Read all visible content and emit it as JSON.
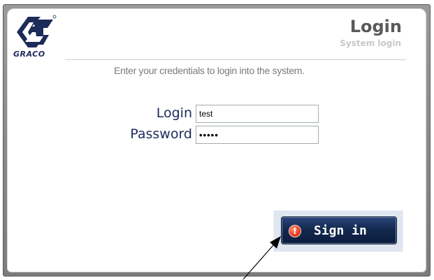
{
  "header": {
    "logo_text": "GRACO",
    "title": "Login",
    "subtitle": "System login"
  },
  "instructions": "Enter your credentials to login into the system.",
  "form": {
    "login_label": "Login",
    "login_value": "test",
    "password_label": "Password",
    "password_value": "•••••"
  },
  "signin_button": {
    "label": "Sign in",
    "icon": "exclamation-icon",
    "icon_glyph": "!"
  },
  "colors": {
    "frame": "#8a8a8a",
    "label_text": "#1d2b5a",
    "button_bg": "#14294f",
    "button_icon": "#e23b1a",
    "title_text": "#5a5a5a",
    "subtitle_text": "#c8c8c8"
  },
  "annotation": {
    "arrow": "callout-arrow"
  }
}
